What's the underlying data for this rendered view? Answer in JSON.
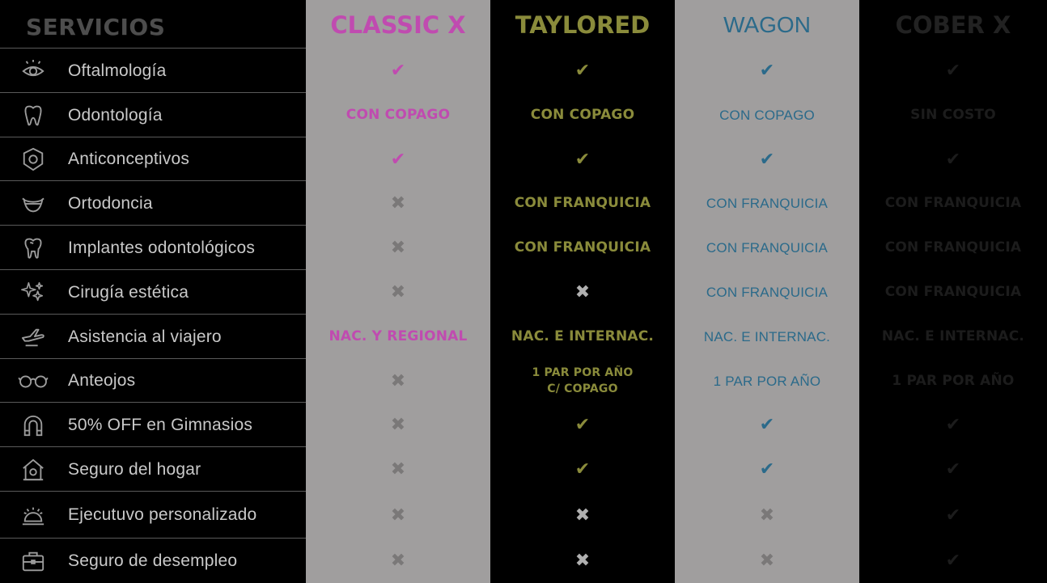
{
  "header": {
    "services_title": "SERVICIOS",
    "plans": [
      {
        "name": "CLASSIC X",
        "color": "#c04bb0",
        "background": "#a09e9e"
      },
      {
        "name": "TAYLORED",
        "color": "#8a8b3b",
        "background": "#000000"
      },
      {
        "name": "WAGON",
        "color": "#2b6a8a",
        "background": "#a09e9e"
      },
      {
        "name": "COBER X",
        "color": "#222222",
        "background": "#000000"
      }
    ]
  },
  "services": [
    {
      "label": "Oftalmología",
      "icon": "eye-icon",
      "cells": [
        "check",
        "check",
        "check",
        "check"
      ]
    },
    {
      "label": "Odontología",
      "icon": "tooth-icon",
      "cells": [
        "CON COPAGO",
        "CON COPAGO",
        "CON COPAGO",
        "SIN COSTO"
      ]
    },
    {
      "label": "Anticonceptivos",
      "icon": "shield-icon",
      "cells": [
        "check",
        "check",
        "check",
        "check"
      ]
    },
    {
      "label": "Ortodoncia",
      "icon": "braces-smile-icon",
      "cells": [
        "cross",
        "CON FRANQUICIA",
        "CON FRANQUICIA",
        "CON FRANQUICIA"
      ]
    },
    {
      "label": "Implantes odontológicos",
      "icon": "tooth-implant-icon",
      "cells": [
        "cross",
        "CON FRANQUICIA",
        "CON FRANQUICIA",
        "CON FRANQUICIA"
      ]
    },
    {
      "label": "Cirugía estética",
      "icon": "sparkles-icon",
      "cells": [
        "cross",
        "cross",
        "CON FRANQUICIA",
        "CON FRANQUICIA"
      ]
    },
    {
      "label": "Asistencia al  viajero",
      "icon": "airplane-icon",
      "cells": [
        "NAC. Y REGIONAL",
        "NAC.  E INTERNAC.",
        "NAC. E INTERNAC.",
        "NAC. E INTERNAC."
      ]
    },
    {
      "label": "Anteojos",
      "icon": "glasses-icon",
      "cells": [
        "cross",
        "1 PAR POR AÑO\nC/ COPAGO",
        "1 PAR POR AÑO",
        "1 PAR POR AÑO"
      ]
    },
    {
      "label": "50% OFF en Gimnasios",
      "icon": "magnet-icon",
      "cells": [
        "cross",
        "check",
        "check",
        "check"
      ]
    },
    {
      "label": "Seguro del hogar",
      "icon": "house-icon",
      "cells": [
        "cross",
        "check",
        "check",
        "check"
      ]
    },
    {
      "label": "Ejecutuvo personalizado",
      "icon": "service-bell-icon",
      "cells": [
        "cross",
        "cross",
        "cross",
        "check"
      ]
    },
    {
      "label": "Seguro de desempleo",
      "icon": "briefcase-icon",
      "cells": [
        "cross",
        "cross",
        "cross",
        "check"
      ]
    }
  ],
  "marks": {
    "check": "✔",
    "cross": "✖"
  },
  "mark_colors": [
    "#c04bb0",
    "#8a8b3b",
    "#2b6a8a",
    "#1c1c1c"
  ],
  "cross_colors": [
    "#7a7878",
    "#b0b0b0",
    "#7a7878",
    "#1c1c1c"
  ]
}
